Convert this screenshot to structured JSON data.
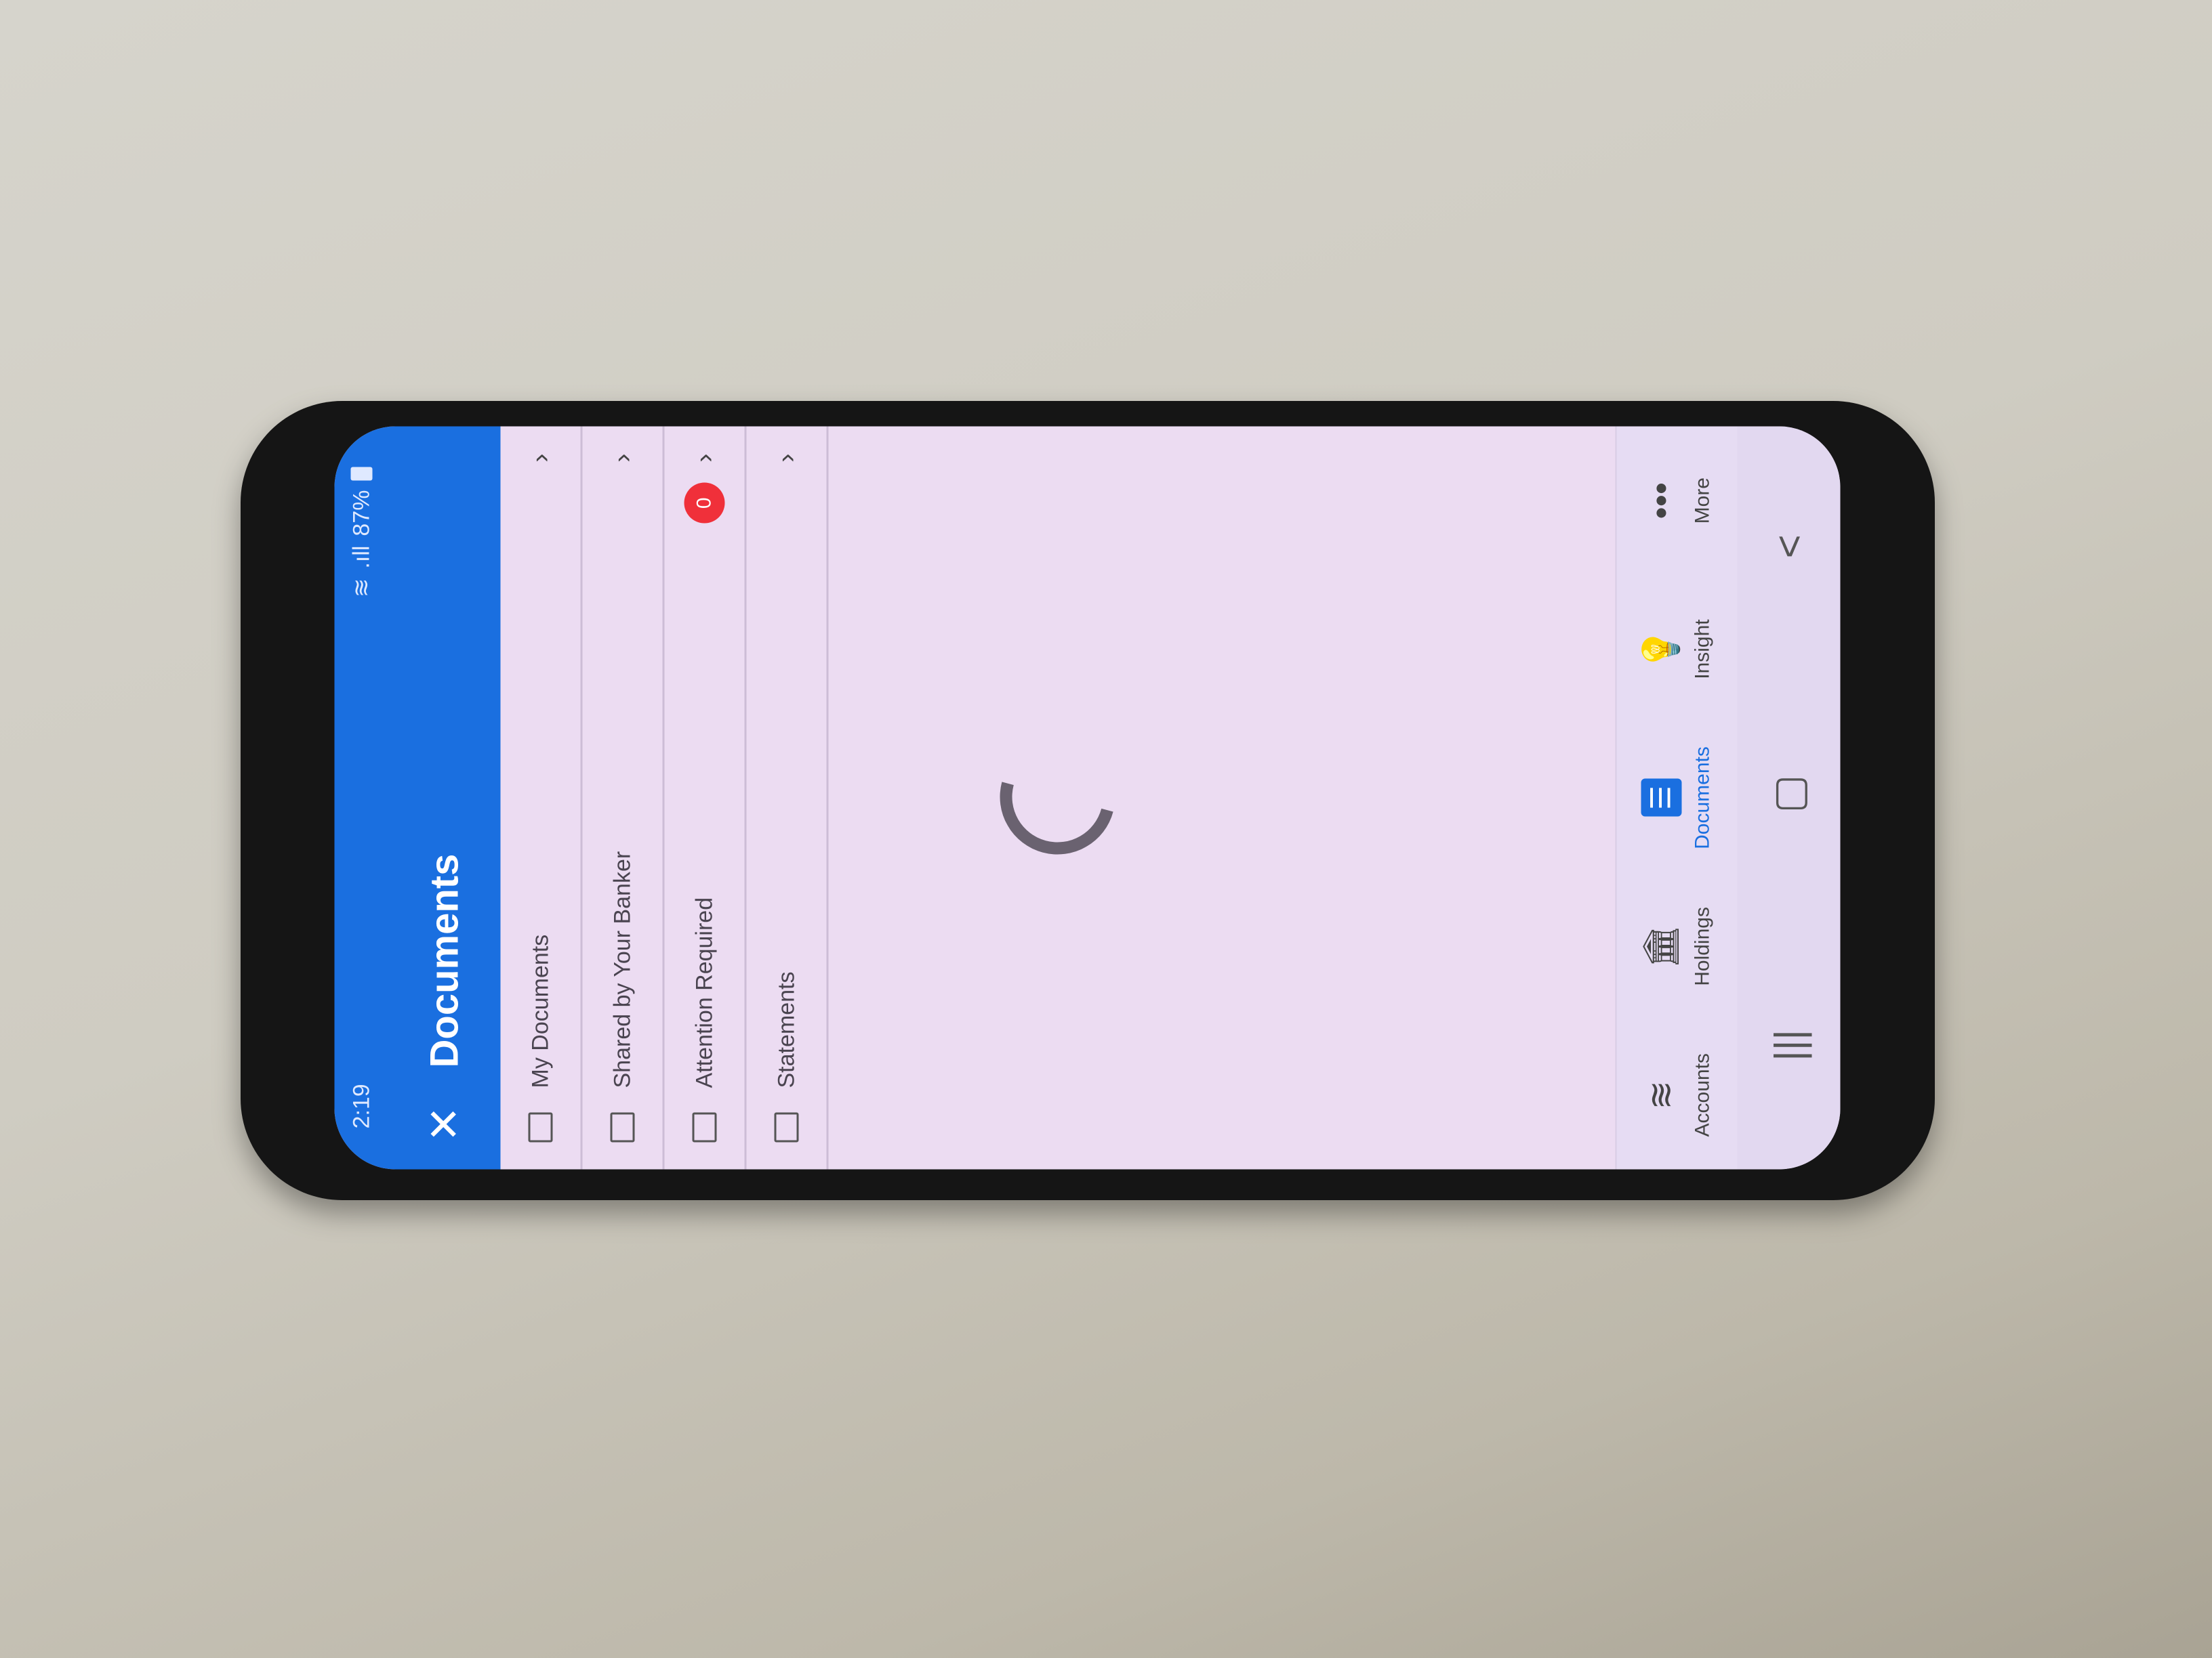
{
  "status_bar": {
    "time": "2:19",
    "signal": ".ıll",
    "battery": "87%"
  },
  "header": {
    "title": "Documents",
    "close_icon": "close-icon"
  },
  "folders": [
    {
      "label": "My Documents"
    },
    {
      "label": "Shared by Your Banker"
    },
    {
      "label": "Attention Required",
      "badge": "0"
    },
    {
      "label": "Statements"
    }
  ],
  "tabs": [
    {
      "label": "Accounts",
      "icon": "coins-icon",
      "glyph": "≋"
    },
    {
      "label": "Holdings",
      "icon": "bank-icon",
      "glyph": "🏛"
    },
    {
      "label": "Documents",
      "icon": "document-icon",
      "glyph": "☰",
      "active": true
    },
    {
      "label": "Insight",
      "icon": "lightbulb-icon",
      "glyph": "💡"
    },
    {
      "label": "More",
      "icon": "more-icon",
      "glyph": "•••"
    }
  ],
  "system_nav": {
    "recents": "|||",
    "home": "▢",
    "back": "<"
  },
  "colors": {
    "accent": "#1a6fe0",
    "badge": "#f0303a"
  }
}
